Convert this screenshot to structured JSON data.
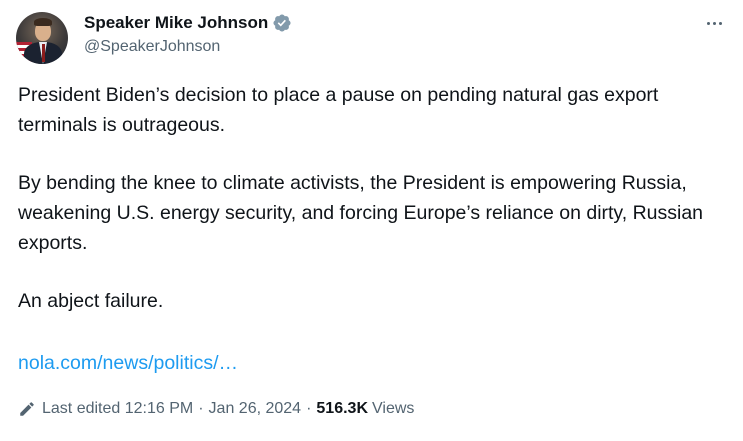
{
  "author": {
    "display_name": "Speaker Mike Johnson",
    "handle": "@SpeakerJohnson",
    "verified_icon": "verified-badge-icon",
    "verified_color": "#829aab"
  },
  "tweet": {
    "paragraphs": [
      "President Biden’s decision to place a pause on pending natural gas export terminals is outrageous.",
      "By bending the knee to climate activists, the President is empowering Russia, weakening U.S. energy security, and forcing Europe’s reliance on dirty, Russian exports.",
      "An abject failure."
    ],
    "link": "nola.com/news/politics/…"
  },
  "meta": {
    "edited_label": "Last edited",
    "time": "12:16 PM",
    "separator": "·",
    "date": "Jan 26, 2024",
    "views_count": "516.3K",
    "views_label": "Views"
  },
  "colors": {
    "text": "#0f1419",
    "secondary": "#536471",
    "link": "#1d9bf0"
  }
}
